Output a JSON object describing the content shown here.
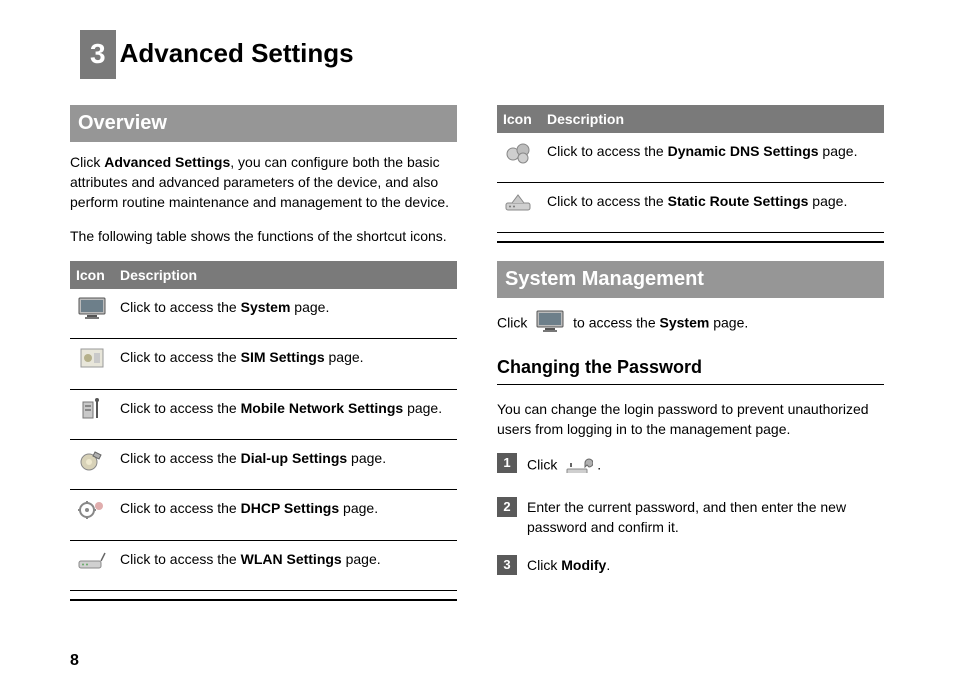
{
  "chapter": {
    "num": "3",
    "title": "Advanced Settings"
  },
  "page_number": "8",
  "col_left": {
    "overview_head": "Overview",
    "overview_p1_a": "Click ",
    "overview_p1_b": "Advanced Settings",
    "overview_p1_c": ", you can configure both the basic attributes and advanced parameters of the device, and also perform routine maintenance and management to the device.",
    "overview_p2": "The following table shows the functions of the shortcut icons.",
    "th_icon": "Icon",
    "th_desc": "Description",
    "rows": [
      {
        "iconname": "monitor-icon",
        "a": "Click to access the ",
        "b": "System",
        "c": " page."
      },
      {
        "iconname": "sim-icon",
        "a": "Click to access the ",
        "b": "SIM Settings",
        "c": " page."
      },
      {
        "iconname": "antenna-icon",
        "a": "Click to access the ",
        "b": "Mobile Network Settings",
        "c": " page."
      },
      {
        "iconname": "dialup-icon",
        "a": "Click to access the ",
        "b": "Dial-up Settings",
        "c": " page."
      },
      {
        "iconname": "dhcp-icon",
        "a": "Click to access the ",
        "b": "DHCP Settings",
        "c": " page."
      },
      {
        "iconname": "wlan-icon",
        "a": "Click to access the ",
        "b": "WLAN Settings",
        "c": " page."
      }
    ]
  },
  "col_right": {
    "th_icon": "Icon",
    "th_desc": "Description",
    "rows": [
      {
        "iconname": "ddns-icon",
        "a": "Click to access the ",
        "b": "Dynamic DNS Settings",
        "c": " page."
      },
      {
        "iconname": "route-icon",
        "a": "Click to access the ",
        "b": "Static Route Settings",
        "c": " page."
      }
    ],
    "sysmgmt_head": "System Management",
    "sys_line_a": "Click ",
    "sys_line_b": " to access the ",
    "sys_line_c": "System",
    "sys_line_d": " page.",
    "changepw_head": "Changing the Password",
    "changepw_p": "You can change the login password to prevent unauthorized users from logging in to the management page.",
    "steps": [
      {
        "n": "1",
        "a": "Click ",
        "b": "",
        "c": ".",
        "hasicon": true
      },
      {
        "n": "2",
        "a": "Enter the current password, and then enter the new password and confirm it.",
        "b": "",
        "c": "",
        "hasicon": false
      },
      {
        "n": "3",
        "a": "Click ",
        "b": "Modify",
        "c": ".",
        "hasicon": false
      }
    ]
  }
}
